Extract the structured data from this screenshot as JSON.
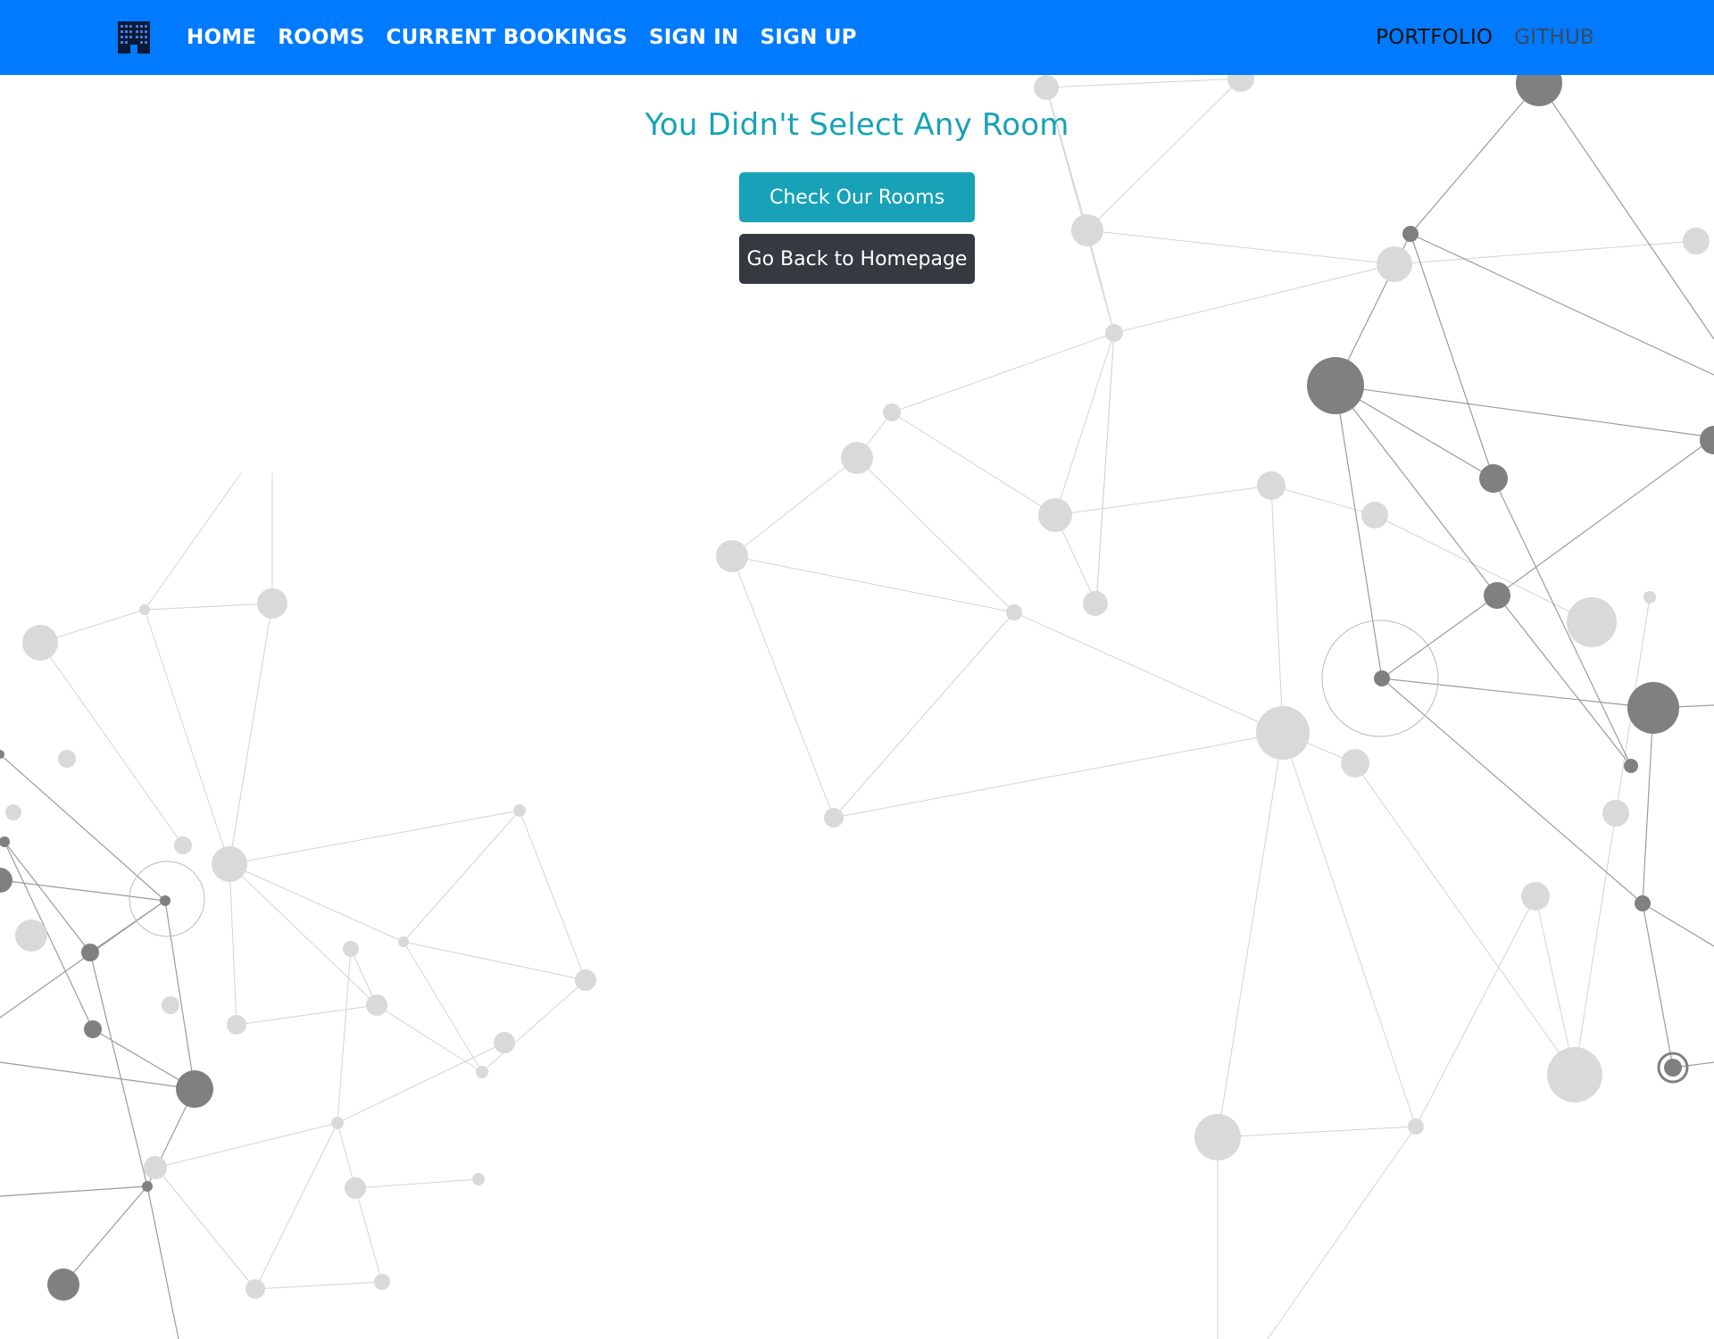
{
  "navbar": {
    "brand_icon": "hotel-building-icon",
    "links": [
      {
        "label": "HOME"
      },
      {
        "label": "ROOMS"
      },
      {
        "label": "CURRENT BOOKINGS"
      },
      {
        "label": "SIGN IN"
      },
      {
        "label": "SIGN UP"
      }
    ],
    "right_links": [
      {
        "label": "PORTFOLIO"
      },
      {
        "label": "GITHUB"
      }
    ],
    "background_color": "#007bff"
  },
  "main": {
    "title": "You Didn't Select Any Room",
    "check_rooms_label": "Check Our Rooms",
    "back_home_label": "Go Back to Homepage",
    "title_color": "#17a2b8",
    "check_rooms_color": "#17a2b8",
    "back_home_color": "#343a40"
  },
  "background": {
    "pattern": "network-graph",
    "node_color_light": "#d8d8d8",
    "node_color_dark": "#808080"
  }
}
